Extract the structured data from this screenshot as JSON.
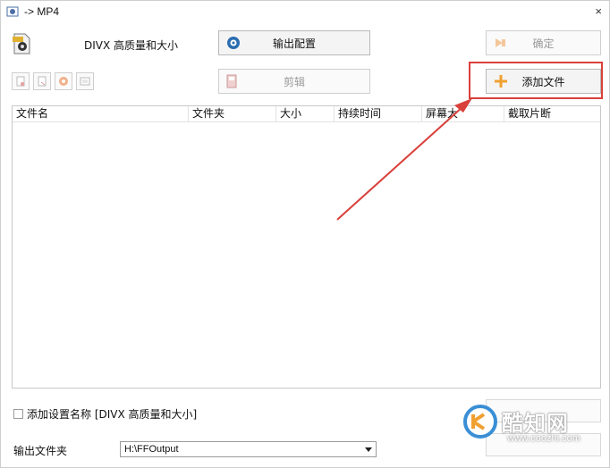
{
  "window": {
    "title": "-> MP4",
    "close_glyph": "×"
  },
  "profile": {
    "label": "DIVX 高质量和大小",
    "icon": "video-file-icon"
  },
  "buttons": {
    "output_config": "输出配置",
    "ok": "确定",
    "clip": "剪辑",
    "add_file": "添加文件"
  },
  "toolbar_icons": [
    "remove-file-icon",
    "clear-list-icon",
    "play-icon",
    "media-info-icon"
  ],
  "file_list": {
    "columns": [
      "文件名",
      "文件夹",
      "大小",
      "持续时间",
      "屏幕大",
      "截取片断"
    ],
    "rows": []
  },
  "options": {
    "append_setting_name": "添加设置名称 [DIVX 高质量和大小]",
    "append_setting_checked": false,
    "output_folder_label": "输出文件夹",
    "output_folder_value": "H:\\FFOutput"
  },
  "watermark": {
    "name": "酷知网",
    "url": "www.coozhi.com"
  },
  "colors": {
    "highlight": "#d9403a",
    "arrow": "#d9403a",
    "plus": "#f0a030"
  }
}
